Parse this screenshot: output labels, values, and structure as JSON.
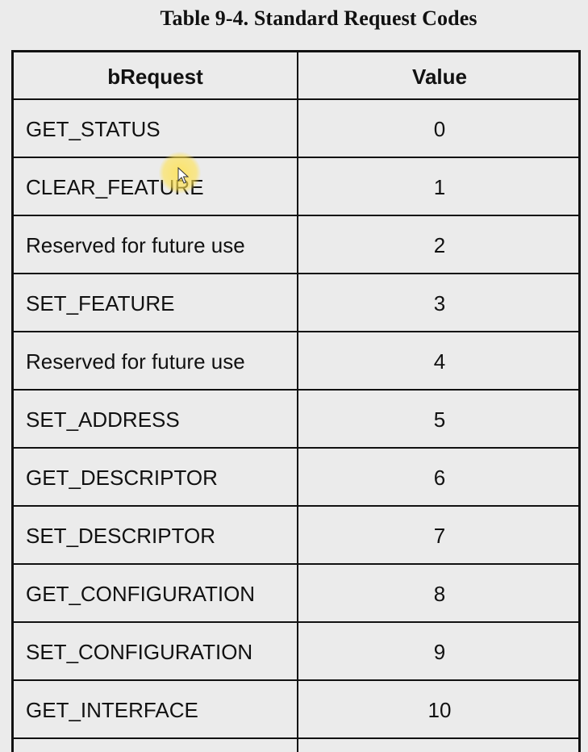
{
  "caption": "Table 9-4.  Standard Request Codes",
  "table": {
    "headers": [
      "bRequest",
      "Value"
    ],
    "rows": [
      {
        "name": "GET_STATUS",
        "value": "0"
      },
      {
        "name": "CLEAR_FEATURE",
        "value": "1"
      },
      {
        "name": "Reserved for future use",
        "value": "2"
      },
      {
        "name": "SET_FEATURE",
        "value": "3"
      },
      {
        "name": "Reserved for future use",
        "value": "4"
      },
      {
        "name": "SET_ADDRESS",
        "value": "5"
      },
      {
        "name": "GET_DESCRIPTOR",
        "value": "6"
      },
      {
        "name": "SET_DESCRIPTOR",
        "value": "7"
      },
      {
        "name": "GET_CONFIGURATION",
        "value": "8"
      },
      {
        "name": "SET_CONFIGURATION",
        "value": "9"
      },
      {
        "name": "GET_INTERFACE",
        "value": "10"
      }
    ]
  },
  "cursor": {
    "highlight_color": "#ffe250"
  }
}
